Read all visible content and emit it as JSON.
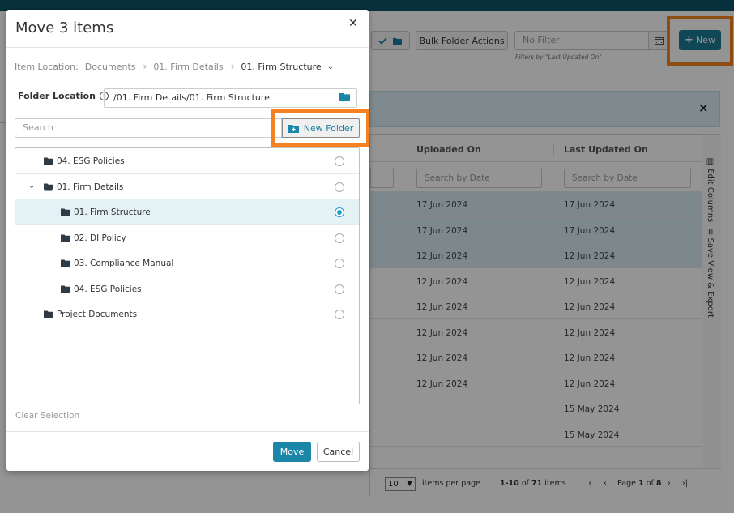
{
  "background": {
    "toolbar": {
      "bulk_actions_label": "Bulk Folder Actions",
      "filter_placeholder": "No Filter",
      "filter_hint": "Filters by \"Last Updated On\"",
      "new_label": "New"
    },
    "grid": {
      "columns": [
        "Uploaded On",
        "Last Updated On"
      ],
      "search_placeholder": "Search by Date",
      "rows": [
        {
          "uploaded": "17 Jun 2024",
          "updated": "17 Jun 2024",
          "selected": true
        },
        {
          "uploaded": "17 Jun 2024",
          "updated": "17 Jun 2024",
          "selected": true
        },
        {
          "uploaded": "12 Jun 2024",
          "updated": "12 Jun 2024",
          "selected": true
        },
        {
          "uploaded": "12 Jun 2024",
          "updated": "12 Jun 2024",
          "selected": false
        },
        {
          "uploaded": "12 Jun 2024",
          "updated": "12 Jun 2024",
          "selected": false
        },
        {
          "uploaded": "12 Jun 2024",
          "updated": "12 Jun 2024",
          "selected": false
        },
        {
          "uploaded": "12 Jun 2024",
          "updated": "12 Jun 2024",
          "selected": false
        },
        {
          "uploaded": "12 Jun 2024",
          "updated": "12 Jun 2024",
          "selected": false
        },
        {
          "uploaded": "",
          "updated": "15 May 2024",
          "selected": false
        },
        {
          "uploaded": "",
          "updated": "15 May 2024",
          "selected": false
        }
      ],
      "side_tabs": [
        "Edit Columns",
        "Save View & Export"
      ],
      "pager": {
        "per_page_value": "10",
        "per_page_label": "items per page",
        "range": "1-10",
        "of_word": "of",
        "total": "71",
        "items_word": "items",
        "page_word": "Page",
        "page": "1",
        "pages": "8"
      }
    }
  },
  "modal": {
    "title": "Move 3 items",
    "breadcrumb": {
      "label": "Item Location:",
      "items": [
        "Documents",
        "01. Firm Details",
        "01. Firm Structure"
      ]
    },
    "folder_location_label": "Folder Location",
    "folder_location_value": "/01. Firm Details/01. Firm Structure",
    "search_placeholder": "Search",
    "new_folder_label": "New Folder",
    "tree": [
      {
        "label": "04. ESG Policies",
        "level": 1,
        "open": false,
        "selected": false
      },
      {
        "label": "01. Firm Details",
        "level": 1,
        "open": true,
        "selected": false
      },
      {
        "label": "01. Firm Structure",
        "level": 2,
        "open": false,
        "selected": true
      },
      {
        "label": "02. DI Policy",
        "level": 2,
        "open": false,
        "selected": false
      },
      {
        "label": "03. Compliance Manual",
        "level": 2,
        "open": false,
        "selected": false
      },
      {
        "label": "04. ESG Policies",
        "level": 2,
        "open": false,
        "selected": false
      },
      {
        "label": "Project Documents",
        "level": 1,
        "open": false,
        "selected": false
      }
    ],
    "clear_selection_label": "Clear Selection",
    "move_label": "Move",
    "cancel_label": "Cancel"
  },
  "colors": {
    "primary": "#1a86a8",
    "highlight": "#f58220",
    "selected_row": "#e4f1f5",
    "radio_on": "#1a9fcf"
  },
  "icons": [
    "close-icon",
    "info-icon",
    "folder-icon",
    "folder-open-icon",
    "folder-plus-icon",
    "chevron-down-icon",
    "calendar-icon",
    "plus-icon",
    "check-icon"
  ]
}
